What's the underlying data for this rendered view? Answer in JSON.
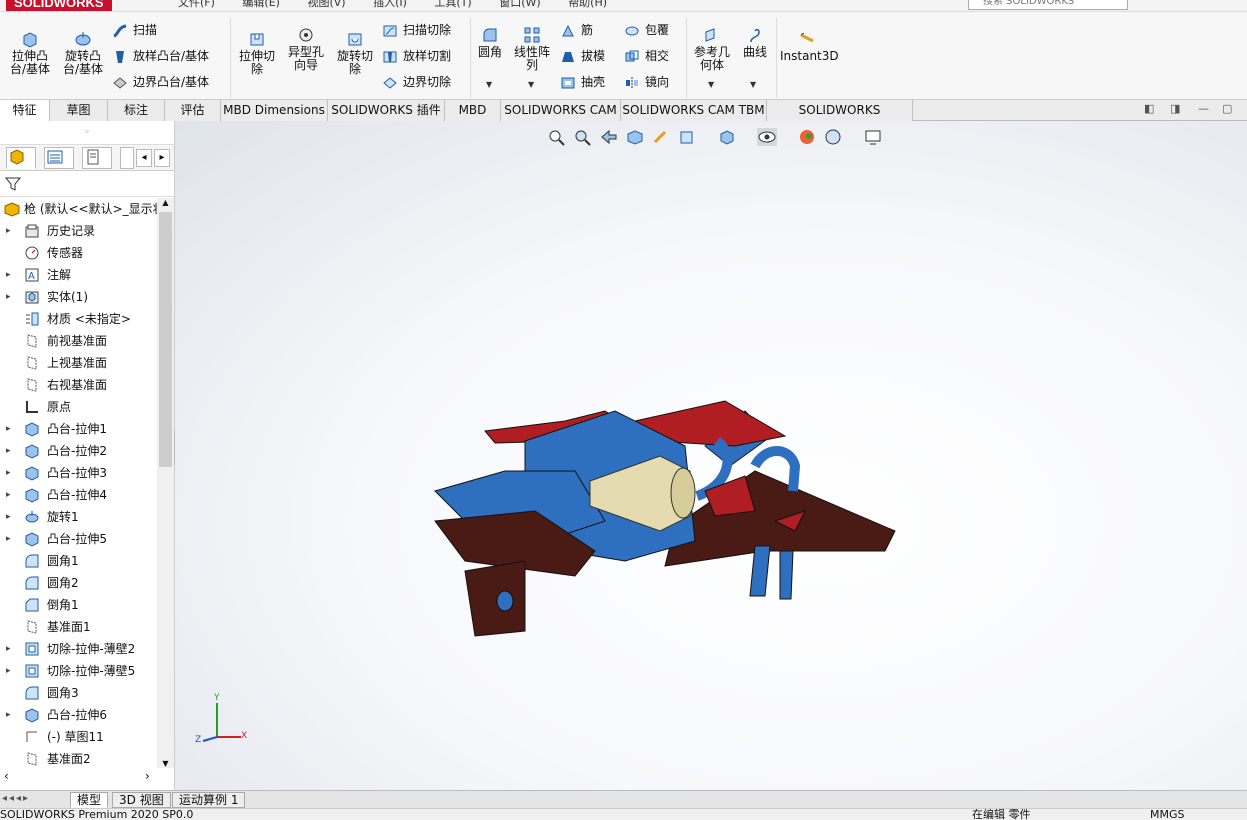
{
  "app": {
    "logo": "SOLIDWORKS",
    "menus": [
      "文件(F)",
      "编辑(E)",
      "视图(V)",
      "插入(I)",
      "工具(T)",
      "窗口(W)",
      "帮助(H)"
    ],
    "search_placeholder": "搜索 SOLIDWORKS"
  },
  "ribbon": {
    "extrude_boss": "拉伸凸\n台/基体",
    "revolve_boss": "旋转凸\n台/基体",
    "sweep": "扫描",
    "loft_boss": "放样凸台/基体",
    "boundary_boss": "边界凸台/基体",
    "extrude_cut": "拉伸切\n除",
    "hole_wizard": "异型孔\n向导",
    "revolve_cut": "旋转切\n除",
    "swept_cut": "扫描切除",
    "lofted_cut": "放样切割",
    "boundary_cut": "边界切除",
    "fillet": "圆角",
    "linear_pattern": "线性阵\n列",
    "rib": "筋",
    "draft": "拔模",
    "shell": "抽壳",
    "wrap": "包覆",
    "intersect": "相交",
    "mirror": "镜向",
    "ref_geometry": "参考几\n何体",
    "curves": "曲线",
    "instant3d": "Instant3D"
  },
  "tabs": [
    "特征",
    "草图",
    "标注",
    "评估",
    "MBD Dimensions",
    "SOLIDWORKS 插件",
    "MBD",
    "SOLIDWORKS CAM",
    "SOLIDWORKS CAM TBM",
    "SOLIDWORKS Inspection"
  ],
  "tree": {
    "root": "枪 (默认<<默认>_显示状态",
    "items": [
      {
        "label": "历史记录",
        "expand": true,
        "icon": "folder-icon"
      },
      {
        "label": "传感器",
        "expand": false,
        "icon": "sensor-icon"
      },
      {
        "label": "注解",
        "expand": true,
        "icon": "annotation-icon"
      },
      {
        "label": "实体(1)",
        "expand": true,
        "icon": "solid-bodies-icon"
      },
      {
        "label": "材质 <未指定>",
        "expand": false,
        "icon": "material-icon"
      },
      {
        "label": "前视基准面",
        "expand": false,
        "icon": "plane-icon"
      },
      {
        "label": "上视基准面",
        "expand": false,
        "icon": "plane-icon"
      },
      {
        "label": "右视基准面",
        "expand": false,
        "icon": "plane-icon"
      },
      {
        "label": "原点",
        "expand": false,
        "icon": "origin-icon"
      },
      {
        "label": "凸台-拉伸1",
        "expand": true,
        "icon": "extrude-icon"
      },
      {
        "label": "凸台-拉伸2",
        "expand": true,
        "icon": "extrude-icon"
      },
      {
        "label": "凸台-拉伸3",
        "expand": true,
        "icon": "extrude-icon"
      },
      {
        "label": "凸台-拉伸4",
        "expand": true,
        "icon": "extrude-icon"
      },
      {
        "label": "旋转1",
        "expand": true,
        "icon": "revolve-icon"
      },
      {
        "label": "凸台-拉伸5",
        "expand": true,
        "icon": "extrude-icon"
      },
      {
        "label": "圆角1",
        "expand": false,
        "icon": "fillet-icon"
      },
      {
        "label": "圆角2",
        "expand": false,
        "icon": "fillet-icon"
      },
      {
        "label": "倒角1",
        "expand": false,
        "icon": "chamfer-icon"
      },
      {
        "label": "基准面1",
        "expand": false,
        "icon": "plane-icon"
      },
      {
        "label": "切除-拉伸-薄壁2",
        "expand": true,
        "icon": "cut-extrude-icon"
      },
      {
        "label": "切除-拉伸-薄壁5",
        "expand": true,
        "icon": "cut-extrude-icon"
      },
      {
        "label": "圆角3",
        "expand": false,
        "icon": "fillet-icon"
      },
      {
        "label": "凸台-拉伸6",
        "expand": true,
        "icon": "extrude-icon"
      },
      {
        "label": "(-) 草图11",
        "expand": false,
        "icon": "sketch-icon"
      },
      {
        "label": "基准面2",
        "expand": false,
        "icon": "plane-icon"
      }
    ]
  },
  "bottom_tabs": [
    "模型",
    "3D 视图",
    "运动算例 1"
  ],
  "status": {
    "left": "SOLIDWORKS Premium 2020 SP0.0",
    "editing": "在编辑 零件",
    "units": "MMGS"
  },
  "triad": {
    "x": "X",
    "y": "Y",
    "z": "Z"
  },
  "colors": {
    "accent": "#c8102e",
    "part_blue": "#2f6fc0",
    "part_red": "#b01e24",
    "part_brown": "#4a1a14",
    "part_cream": "#e4dcb0"
  }
}
